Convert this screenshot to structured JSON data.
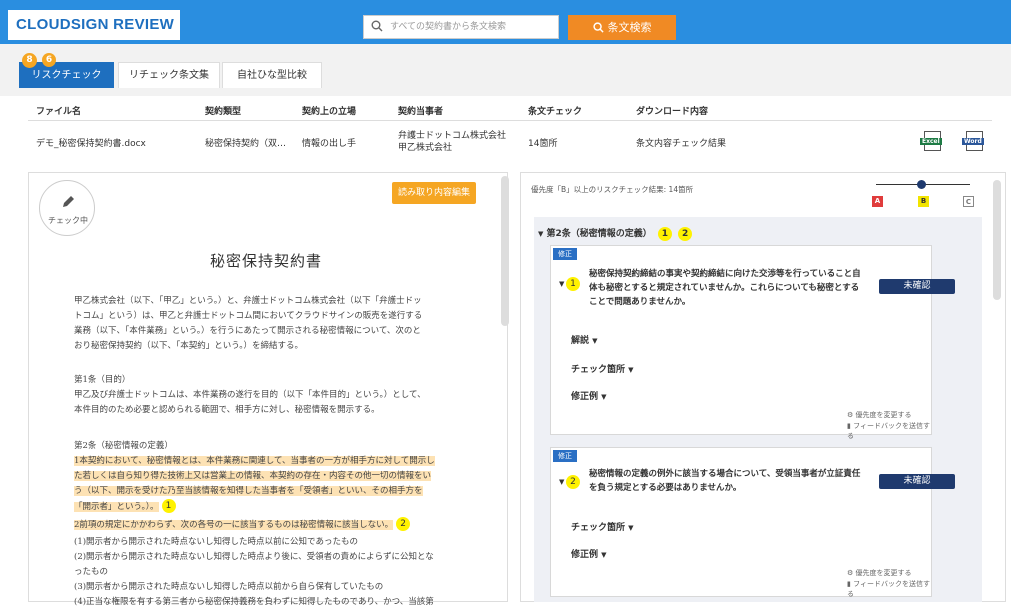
{
  "app": {
    "title": "CLOUDSIGN REVIEW"
  },
  "search": {
    "placeholder": "すべての契約書から条文検索",
    "button_label": "条文検索"
  },
  "tabs": [
    {
      "label": "リスクチェック",
      "badge1": "8",
      "badge2": "6"
    },
    {
      "label": "リチェック条文集"
    },
    {
      "label": "自社ひな型比較"
    }
  ],
  "table": {
    "headers": [
      "ファイル名",
      "契約類型",
      "契約上の立場",
      "契約当事者",
      "条文チェック",
      "ダウンロード内容"
    ],
    "row": {
      "file": "デモ_秘密保持契約書.docx",
      "type": "秘密保持契約（双…",
      "position": "情報の出し手",
      "party1": "弁護士ドットコム株式会社",
      "party2": "甲乙株式会社",
      "check": "14箇所",
      "download": "条文内容チェック結果",
      "excel": "Excel",
      "word": "Word"
    }
  },
  "left": {
    "checking_label": "チェック中",
    "edit_button": "読み取り内容編集",
    "doc_title": "秘密保持契約書",
    "intro": [
      "甲乙株式会社（以下、「甲乙」という。）と、弁護士ドットコム株式会社（以下「弁護士ドッ",
      "トコム」という）は、甲乙と弁護士ドットコム間においてクラウドサインの販売を遂行する",
      "業務（以下、「本件業務」という。）を行うにあたって開示される秘密情報について、次のと",
      "おり秘密保持契約（以下、「本契約」という。）を締結する。"
    ],
    "art1_title": "第1条（目的）",
    "art1": [
      "甲乙及び弁護士ドットコムは、本件業務の遂行を目的（以下「本件目的」という。）として、",
      "本件目的のため必要と認められる範囲で、相手方に対し、秘密情報を開示する。"
    ],
    "art2_title": "第2条（秘密情報の定義）",
    "art2_hl": [
      "1本契約において、秘密情報とは、本件業務に関連して、当事者の一方が相手方に対して開示し",
      "た若しくは自ら知り得た技術上又は営業上の情報、本契約の存在・内容その他一切の情報をい",
      "う（以下、開示を受けた乃至当該情報を知得した当事者を「受領者」といい、その相手方を",
      "「開示者」という。）。"
    ],
    "art2_hl2": "2前項の規定にかかわらず、次の各号の一に該当するものは秘密情報に該当しない。",
    "art2_rest": [
      "(1)開示者から開示された時点ないし知得した時点以前に公知であったもの",
      "(2)開示者から開示された時点ないし知得した時点より後に、受領者の責めによらずに公知とな",
      "ったもの",
      "(3)開示者から開示された時点ないし知得した時点以前から自ら保有していたもの",
      "(4)正当な権限を有する第三者から秘密保持義務を負わずに知得したものであり、かつ、当該第"
    ],
    "mark1": "1",
    "mark2": "2"
  },
  "right": {
    "summary": "優先度「B」以上のリスクチェック結果: 14箇所",
    "levels": [
      "A",
      "B",
      "C"
    ],
    "section_title": "第2条（秘密情報の定義）",
    "marks": [
      "1",
      "2"
    ],
    "cards": [
      {
        "tag": "修正",
        "num": "1",
        "question": [
          "秘密保持契約締結の事実や契約締結に向けた交渉等を行っていること自",
          "体も秘密とすると規定されていませんか。これらについても秘密とする",
          "ことで問題ありませんか。"
        ],
        "status": "未確認",
        "expanders": [
          "解説",
          "チェック箇所",
          "修正例"
        ],
        "change_priority": "優先度を変更する",
        "feedback": "フィードバックを送信する"
      },
      {
        "tag": "修正",
        "num": "2",
        "question": [
          "秘密情報の定義の例外に該当する場合について、受領当事者が立証責任",
          "を負う規定とする必要はありませんか。"
        ],
        "status": "未確認",
        "expanders": [
          "チェック箇所",
          "修正例"
        ],
        "change_priority": "優先度を変更する",
        "feedback": "フィードバックを送信する"
      }
    ]
  },
  "colors": {
    "primary": "#2a8ee0",
    "accent": "#f08a24",
    "highlight": "#fde2b4",
    "badge": "#1f3a6e"
  }
}
